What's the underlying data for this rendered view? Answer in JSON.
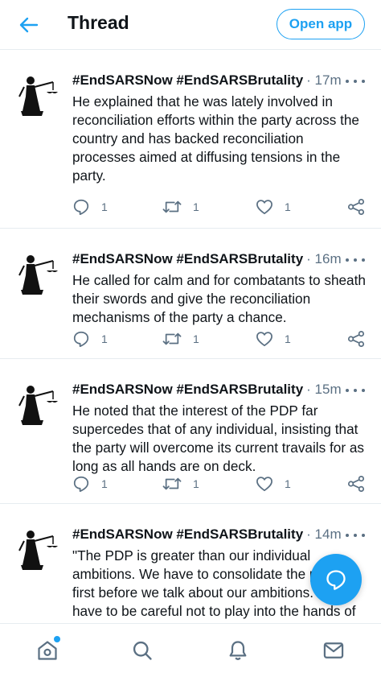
{
  "header": {
    "title": "Thread",
    "open_app_label": "Open app"
  },
  "colors": {
    "accent": "#1da1f2",
    "text": "#0f1419",
    "muted": "#5b7083",
    "divider": "#e6ecf0"
  },
  "tweets": [
    {
      "author": "#EndSARSNow #EndSARSBrutality",
      "time": "· 17m",
      "text": "He explained that he was lately involved in reconciliation efforts within the party across the country and has backed reconciliation processes aimed at diffusing tensions in the party.",
      "replies": "1",
      "retweets": "1",
      "likes": "1"
    },
    {
      "author": "#EndSARSNow #EndSARSBrutality",
      "time": "· 16m",
      "text": "He called for calm and for combatants to sheath their swords and give the reconciliation mechanisms of the party a chance.",
      "replies": "1",
      "retweets": "1",
      "likes": "1"
    },
    {
      "author": "#EndSARSNow #EndSARSBrutality",
      "time": "· 15m",
      "text": "He noted that the interest of the PDP far supercedes that of any individual, insisting that the party will overcome its current travails for as long as all hands are on deck.",
      "replies": "1",
      "retweets": "1",
      "likes": "1"
    },
    {
      "author": "#EndSARSNow #EndSARSBrutality",
      "time": "· 14m",
      "text": "\"The PDP is greater than our individual ambitions. We have to consolidate the party first before we talk about our ambitions. We have to be careful not to play into the hands of the ruling party..."
    }
  ],
  "icons": {
    "back": "arrow-left-icon",
    "more": "more-dots-icon",
    "reply": "reply-icon",
    "retweet": "retweet-icon",
    "like": "heart-icon",
    "share": "share-icon",
    "compose": "compose-icon",
    "home": "home-icon",
    "search": "search-icon",
    "notifications": "bell-icon",
    "messages": "mail-icon"
  }
}
